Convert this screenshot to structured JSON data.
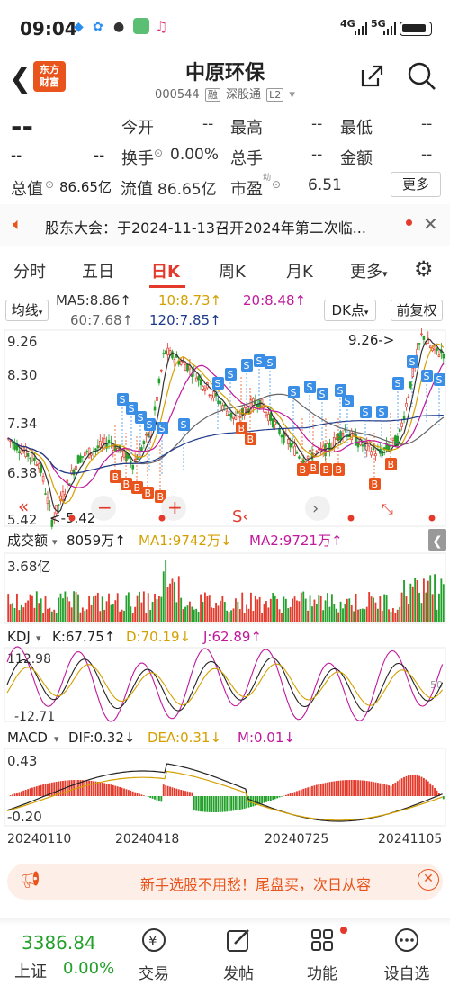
{
  "status": {
    "time": "09:04",
    "net1": "4G",
    "net2": "5G"
  },
  "header": {
    "logo_line1": "东方",
    "logo_line2": "财富",
    "title": "中原环保",
    "code": "000544",
    "tag1": "融",
    "tag2": "深股通",
    "tag3": "L2"
  },
  "quote": {
    "price": "--",
    "change": "--",
    "change_pct": "--",
    "open_label": "今开",
    "open": "--",
    "high_label": "最高",
    "high": "--",
    "low_label": "最低",
    "low": "--",
    "turnover_label": "换手",
    "turnover": "0.00%",
    "volume_label": "总手",
    "volume": "--",
    "amount_label": "金额",
    "amount": "--",
    "mktcap_label": "总值",
    "mktcap": "86.65亿",
    "float_label": "流值",
    "float": "86.65亿",
    "pe_label": "市盈",
    "pe_sup": "动",
    "pe": "6.51",
    "more": "更多"
  },
  "notice": {
    "text": "股东大会：于2024-11-13召开2024年第二次临..."
  },
  "tabs": [
    "分时",
    "五日",
    "日K",
    "周K",
    "月K",
    "更多"
  ],
  "ma": {
    "mode": "均线",
    "ma5": "MA5:8.86",
    "ma10": "10:8.73",
    "ma20": "20:8.48",
    "ma60": "60:7.68",
    "ma120": "120:7.85",
    "dk": "DK点",
    "fq": "前复权",
    "arrow": "↑",
    "c5": "#333333",
    "c10": "#d4a000",
    "c20": "#c0189c",
    "c60": "#666666",
    "c120": "#1e3a8a"
  },
  "price_axis": {
    "top": "9.26",
    "l2": "8.30",
    "l3": "7.34",
    "l4": "6.38",
    "bottom": "5.42",
    "max_mark": "9.26->",
    "min_mark": "<-5.42"
  },
  "vol": {
    "label": "成交额",
    "val": "8059万",
    "ma1": "MA1:9742万",
    "ma2": "MA2:9721万",
    "axis": "3.68亿"
  },
  "kdj": {
    "label": "KDJ",
    "k": "K:67.75",
    "d": "D:70.19",
    "j": "J:62.89",
    "top": "112.98",
    "bottom": "-12.71",
    "r50": "50"
  },
  "macd": {
    "label": "MACD",
    "dif": "DIF:0.32",
    "dea": "DEA:0.31",
    "m": "M:0.01",
    "top": "0.43",
    "bottom": "-0.20"
  },
  "dates": [
    "20240110",
    "20240418",
    "20240725",
    "20241105"
  ],
  "banner": {
    "text": "新手选股不用愁！尾盘买，次日从容"
  },
  "bottom": {
    "index": "3386.84",
    "index_name": "上证",
    "index_chg": "0.00%",
    "trade": "交易",
    "post": "发帖",
    "func": "功能",
    "watch": "设自选"
  },
  "colors": {
    "up": "#e43a2c",
    "down": "#22a02a",
    "accent": "#e8541b"
  }
}
